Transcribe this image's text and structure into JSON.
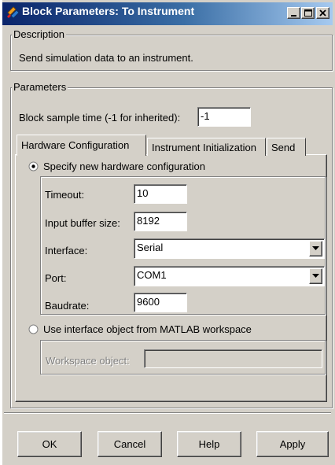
{
  "window": {
    "title": "Block Parameters: To Instrument"
  },
  "description": {
    "legend": "Description",
    "text": "Send simulation data to an instrument."
  },
  "parameters": {
    "legend": "Parameters",
    "sample_time_label": "Block sample time (-1 for inherited):",
    "sample_time_value": "-1"
  },
  "tabs": [
    {
      "label": "Hardware Configuration",
      "active": true
    },
    {
      "label": "Instrument Initialization",
      "active": false
    },
    {
      "label": "Send",
      "active": false
    }
  ],
  "hardware": {
    "specify_new_label": "Specify new hardware configuration",
    "specify_new_selected": true,
    "timeout_label": "Timeout:",
    "timeout_value": "10",
    "input_buffer_label": "Input buffer size:",
    "input_buffer_value": "8192",
    "interface_label": "Interface:",
    "interface_value": "Serial",
    "port_label": "Port:",
    "port_value": "COM1",
    "baudrate_label": "Baudrate:",
    "baudrate_value": "9600",
    "use_interface_label": "Use interface object from MATLAB workspace",
    "use_interface_selected": false,
    "workspace_object_label": "Workspace object:",
    "workspace_object_value": ""
  },
  "buttons": {
    "ok": "OK",
    "cancel": "Cancel",
    "help": "Help",
    "apply": "Apply"
  }
}
